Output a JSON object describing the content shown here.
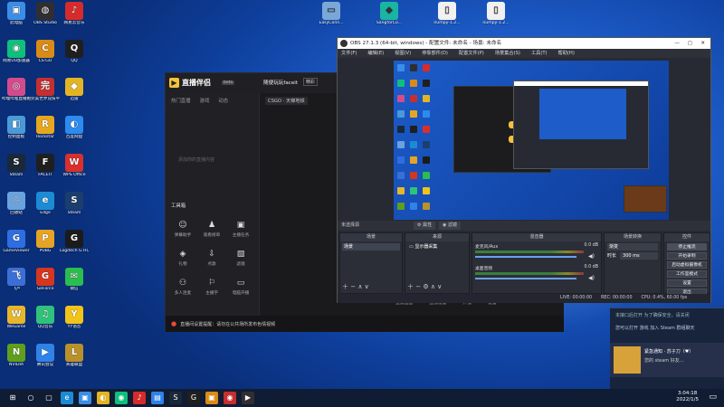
{
  "desktop": {
    "icons": [
      {
        "label": "此电脑",
        "glyph": "▣",
        "color": "#3a8ee6"
      },
      {
        "label": "网易UU加速器",
        "glyph": "◉",
        "color": "#0fbf7c"
      },
      {
        "label": "哔哩哔哩直播姬",
        "glyph": "◎",
        "color": "#d44b8c"
      },
      {
        "label": "控制面板",
        "glyph": "◧",
        "color": "#4a9ad8"
      },
      {
        "label": "Steam",
        "glyph": "S",
        "color": "#1b2838"
      },
      {
        "label": "回收站",
        "glyph": "♲",
        "color": "#6aa2dd"
      },
      {
        "label": "GameViewer",
        "glyph": "G",
        "color": "#2f6ee0"
      },
      {
        "label": "飞卢",
        "glyph": "飞",
        "color": "#3c6fd6"
      },
      {
        "label": "WeGame",
        "glyph": "W",
        "color": "#e8b62a"
      },
      {
        "label": "NVIDIA",
        "glyph": "N",
        "color": "#5f9f1b"
      },
      {
        "label": "OBS Studio",
        "glyph": "◍",
        "color": "#302e31"
      },
      {
        "label": "CS:GO",
        "glyph": "C",
        "color": "#d98b18"
      },
      {
        "label": "完美世界竞技平台",
        "glyph": "完",
        "color": "#c62f2f"
      },
      {
        "label": "Rockstar",
        "glyph": "R",
        "color": "#e6a720"
      },
      {
        "label": "FACEIT",
        "glyph": "F",
        "color": "#1f1f1f"
      },
      {
        "label": "Edge",
        "glyph": "e",
        "color": "#1c8bd4"
      },
      {
        "label": "PUBG",
        "glyph": "P",
        "color": "#e7a424"
      },
      {
        "label": "GeForce",
        "glyph": "G",
        "color": "#d6361f"
      },
      {
        "label": "QQ音乐",
        "glyph": "♫",
        "color": "#30c27b"
      },
      {
        "label": "腾讯会议",
        "glyph": "▶",
        "color": "#2f82e8"
      },
      {
        "label": "网易云音乐",
        "glyph": "♪",
        "color": "#d62b2b"
      },
      {
        "label": "QQ",
        "glyph": "Q",
        "color": "#1f1f1f"
      },
      {
        "label": "迅雷",
        "glyph": "◆",
        "color": "#e3b525"
      },
      {
        "label": "百度网盘",
        "glyph": "◐",
        "color": "#2b8bef"
      },
      {
        "label": "WPS Office",
        "glyph": "W",
        "color": "#d9302c"
      },
      {
        "label": "Steam",
        "glyph": "S",
        "color": "#1b3e6f"
      },
      {
        "label": "Logitech G HUB",
        "glyph": "G",
        "color": "#1b1b1b"
      },
      {
        "label": "微信",
        "glyph": "✉",
        "color": "#2bbd4e"
      },
      {
        "label": "YY语音",
        "glyph": "Y",
        "color": "#f0c419"
      },
      {
        "label": "英雄联盟",
        "glyph": "L",
        "color": "#b8912a"
      }
    ],
    "top_right_icons": [
      {
        "label": "EasyConn...",
        "glyph": "▭",
        "color": "#7aa7d8"
      },
      {
        "label": "SangforCo...",
        "glyph": "◆",
        "color": "#1ab5a2"
      },
      {
        "label": "numpy-1.2...",
        "glyph": "▯",
        "color": "#f1f1f1"
      },
      {
        "label": "numpy-1.2...",
        "glyph": "▯",
        "color": "#f1f1f1"
      }
    ]
  },
  "streaming_app": {
    "title": "直播伴侣",
    "badge": "beta",
    "nav": [
      "热门直播",
      "游戏",
      "动态"
    ],
    "scene_name": "随便玩玩faceit",
    "status_tag": "精彩",
    "stream_tag": "CSGO · 天梯地铁",
    "empty_hint": "添加你的直播内容",
    "features": [
      "弹幕助手",
      "观看榜单",
      "主播任务",
      "礼物",
      "点歌",
      "滤镜",
      "多人连麦",
      "主播学",
      "电脑开播"
    ],
    "tool_section": "工具箱",
    "preview_hint": "复制rtmp地址去直播",
    "btn_start": "开始",
    "btn_stop": "结束",
    "footer_notice": "直播间设置提醒：请勿在公共场所发布色情视频",
    "bottom_actions": [
      "直播画面",
      "直播设置",
      "开播",
      "设置"
    ]
  },
  "obs": {
    "window_title": "OBS 27.1.3 (64-bit, windows) - 配置文件: 未命名 - 场景: 未命名",
    "menu": [
      "文件(F)",
      "编辑(E)",
      "视图(V)",
      "停靠部件(D)",
      "配置文件(P)",
      "场景集合(S)",
      "工具(T)",
      "帮助(H)"
    ],
    "preview_label": "未选择源",
    "btn_properties": "属性",
    "btn_filters": "滤镜",
    "docks": {
      "scenes": {
        "title": "场景",
        "items": [
          "场景"
        ]
      },
      "sources": {
        "title": "来源",
        "items": [
          "显示器采集"
        ]
      },
      "mixer": {
        "title": "混音器",
        "tracks": [
          {
            "name": "麦克风/Aux",
            "level": "0.0 dB"
          },
          {
            "name": "桌面音频",
            "level": "0.0 dB"
          }
        ]
      },
      "transitions": {
        "title": "场景转换",
        "type": "渐变",
        "duration_label": "时长",
        "duration": "300 ms"
      },
      "controls": {
        "title": "控件",
        "buttons": [
          "停止推流",
          "开始录制",
          "启动虚拟摄像机",
          "工作室模式",
          "设置",
          "退出"
        ]
      }
    },
    "status_bar": [
      "LIVE: 00:00:00",
      "REC: 00:00:00",
      "CPU: 0.4%, 60.00 fps"
    ]
  },
  "notification": {
    "bg_text": "本接口后打开 为了确保安全，请关闭",
    "sub_text": "您可以打开 游戏 加入 Steam 群组聊天",
    "sender": "紧急通知 · 苏子刀（♥）",
    "message": "您的 steam 好友..."
  },
  "taskbar": {
    "time": "3:04:18",
    "date": "2022/1/5",
    "apps": [
      "⊞",
      "○",
      "▢",
      "e",
      "▣",
      "◐",
      "◉",
      "♪",
      "▤",
      "S",
      "G",
      "▣",
      "◉",
      "▶"
    ]
  },
  "colors": {
    "accent": "#f5c33b",
    "obs_bg": "#272a33",
    "desktop": "#1d5cc9"
  }
}
